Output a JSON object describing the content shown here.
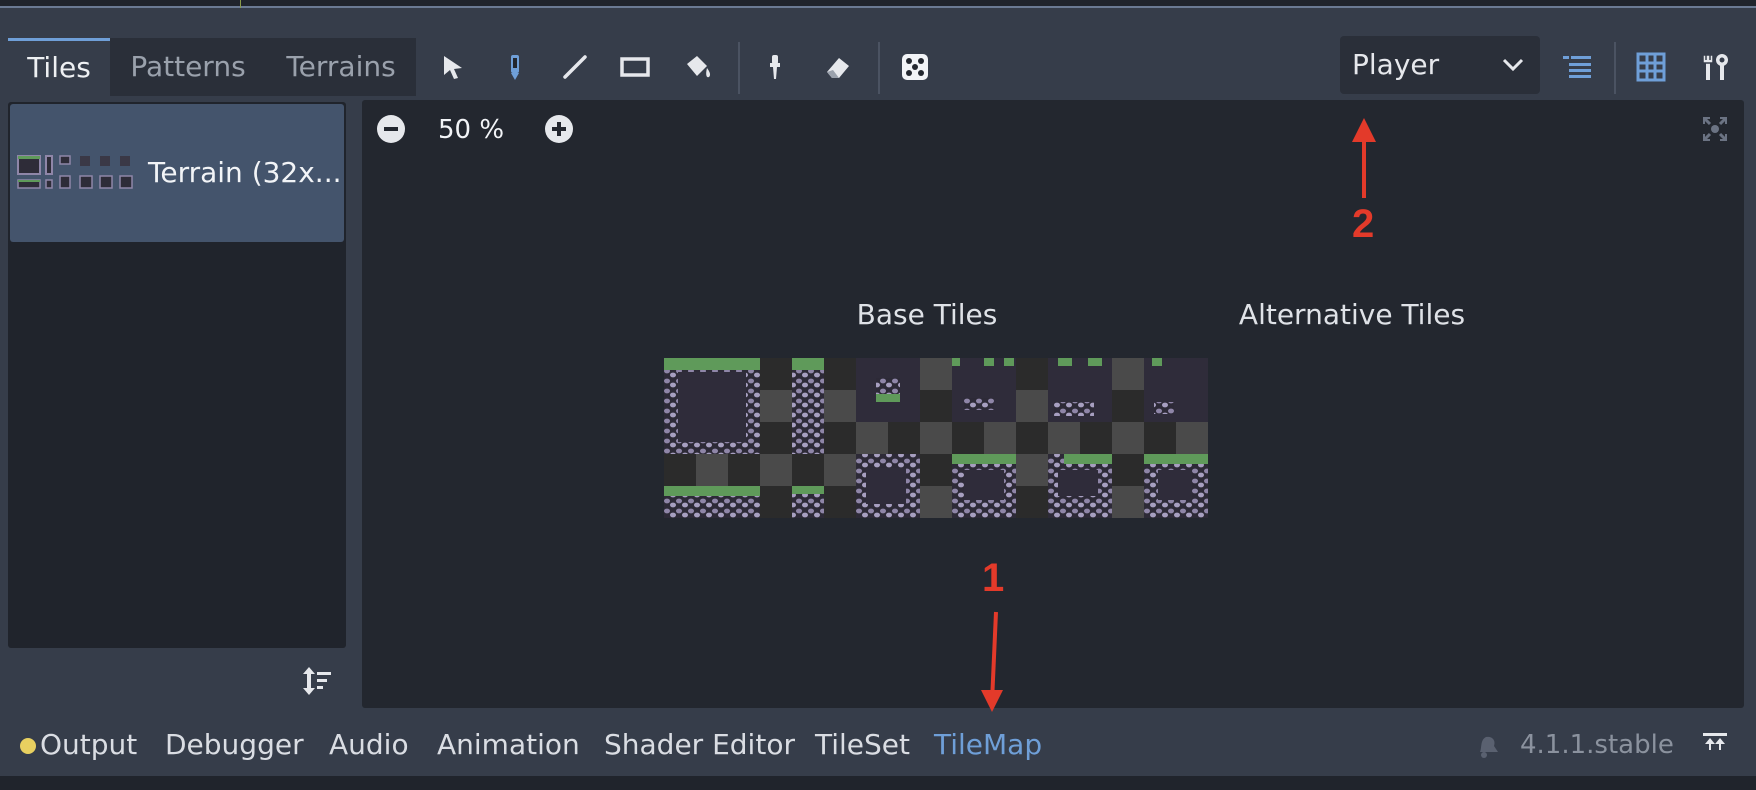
{
  "tabs": [
    {
      "label": "Tiles",
      "active": true
    },
    {
      "label": "Patterns",
      "active": false
    },
    {
      "label": "Terrains",
      "active": false
    }
  ],
  "tools": [
    "select-icon",
    "paint-icon",
    "line-icon",
    "rect-icon",
    "bucket-fill-icon",
    "picker-icon",
    "eraser-icon",
    "dice-icon"
  ],
  "layer_select": {
    "value": "Player"
  },
  "right_tools": [
    "layers-list-icon",
    "grid-icon",
    "tools-icon"
  ],
  "tileset_list": [
    {
      "label": "Terrain (32x..."
    }
  ],
  "zoom": {
    "value": "50 %"
  },
  "atlas": {
    "base_title": "Base Tiles",
    "alt_title": "Alternative Tiles"
  },
  "annotations": [
    {
      "label": "1"
    },
    {
      "label": "2"
    }
  ],
  "bottom_tabs": [
    {
      "label": "Output",
      "active": false
    },
    {
      "label": "Debugger",
      "active": false
    },
    {
      "label": "Audio",
      "active": false
    },
    {
      "label": "Animation",
      "active": false
    },
    {
      "label": "Shader Editor",
      "active": false
    },
    {
      "label": "TileSet",
      "active": false
    },
    {
      "label": "TileMap",
      "active": true
    }
  ],
  "version": "4.1.1.stable",
  "colors": {
    "accent": "#6f9fd8",
    "annotation": "#e33a2a",
    "output_dot": "#e8d060"
  }
}
